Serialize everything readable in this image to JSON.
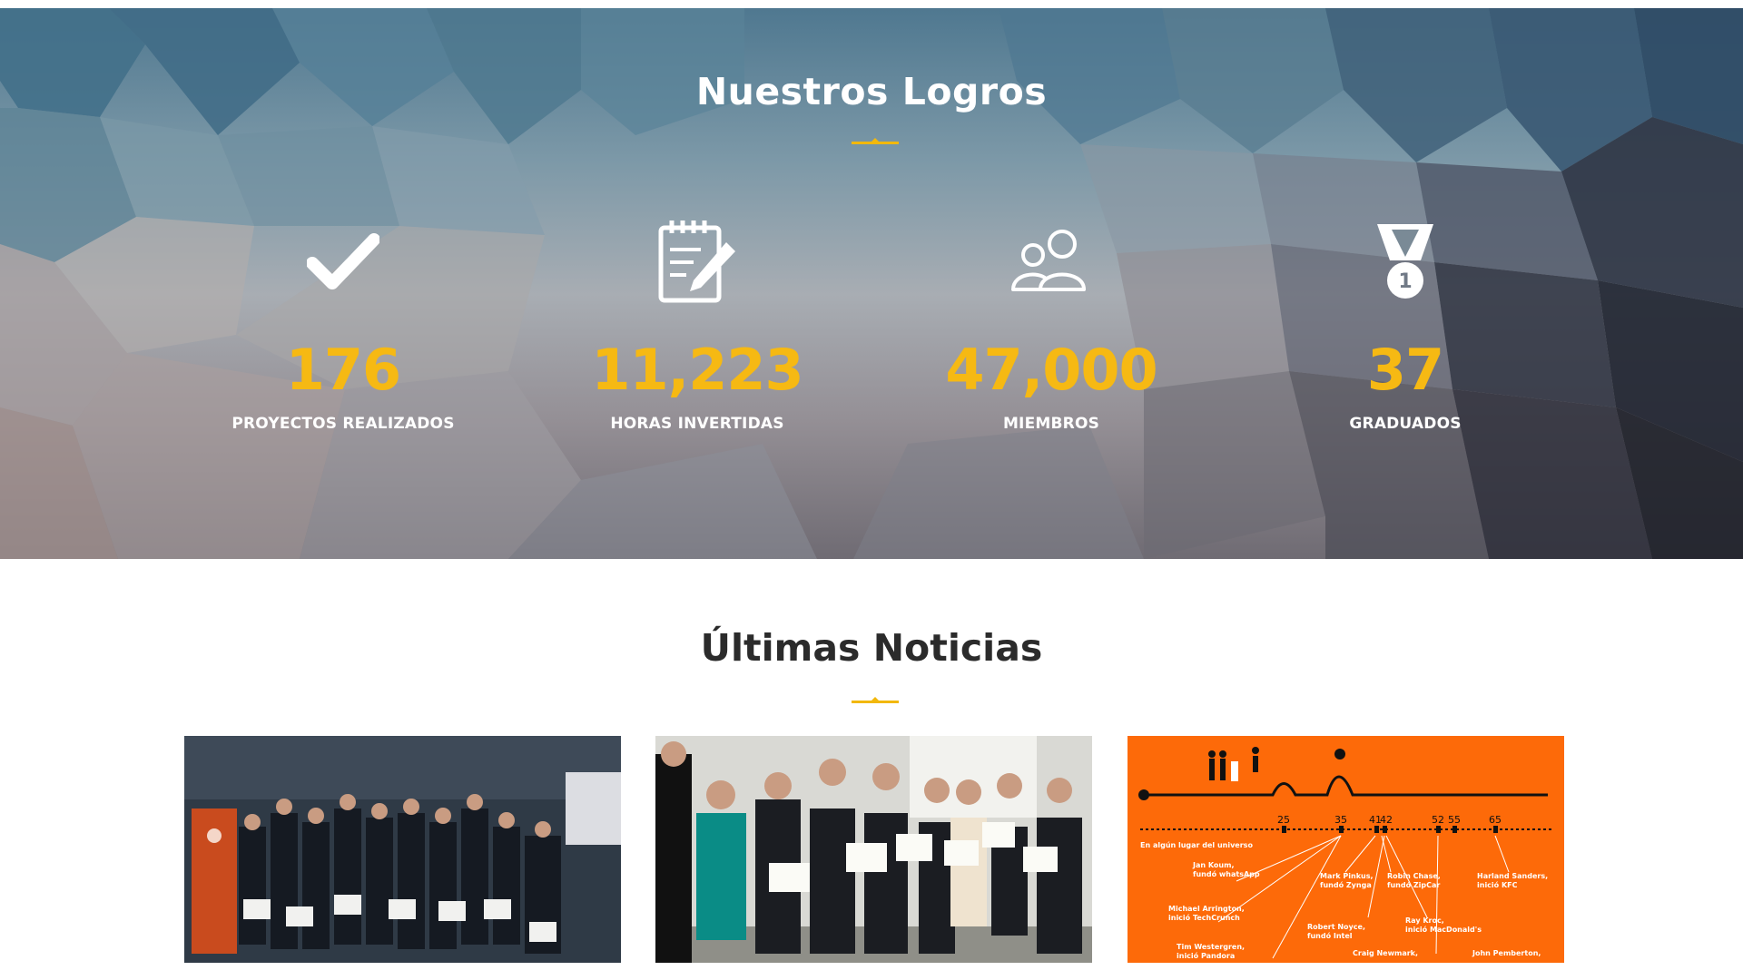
{
  "achievements": {
    "title": "Nuestros Logros",
    "accent_color": "#f2b80c",
    "stats": [
      {
        "icon": "checkmark-icon",
        "value": "176",
        "label": "PROYECTOS REALIZADOS"
      },
      {
        "icon": "notepad-pencil-icon",
        "value": "11,223",
        "label": "HORAS INVERTIDAS"
      },
      {
        "icon": "users-icon",
        "value": "47,000",
        "label": "MIEMBROS"
      },
      {
        "icon": "medal-icon",
        "value": "37",
        "label": "GRADUADOS"
      }
    ]
  },
  "news": {
    "title": "Últimas Noticias",
    "cards": [
      {
        "image": "group-photo-graduates-with-diplomas"
      },
      {
        "image": "group-photo-certificate-ceremony"
      },
      {
        "image": "orange-timeline-infographic",
        "timeline": {
          "ages": [
            "25",
            "35",
            "41",
            "42",
            "52",
            "55",
            "65"
          ],
          "texts": [
            "En algún lugar del universo",
            "Jan Koum,",
            "fundó whatsApp",
            "Mark Pinkus,",
            "fundó Zynga",
            "Robin Chase,",
            "fundó ZipCar",
            "Harland Sanders,",
            "inició KFC",
            "Michael Arrington,",
            "inició TechCrunch",
            "Robert Noyce,",
            "fundó Intel",
            "Ray Kroc,",
            "inició MacDonald's",
            "Tim Westergren,",
            "inició Pandora",
            "Craig Newmark,",
            "John Pemberton,"
          ]
        }
      }
    ]
  }
}
